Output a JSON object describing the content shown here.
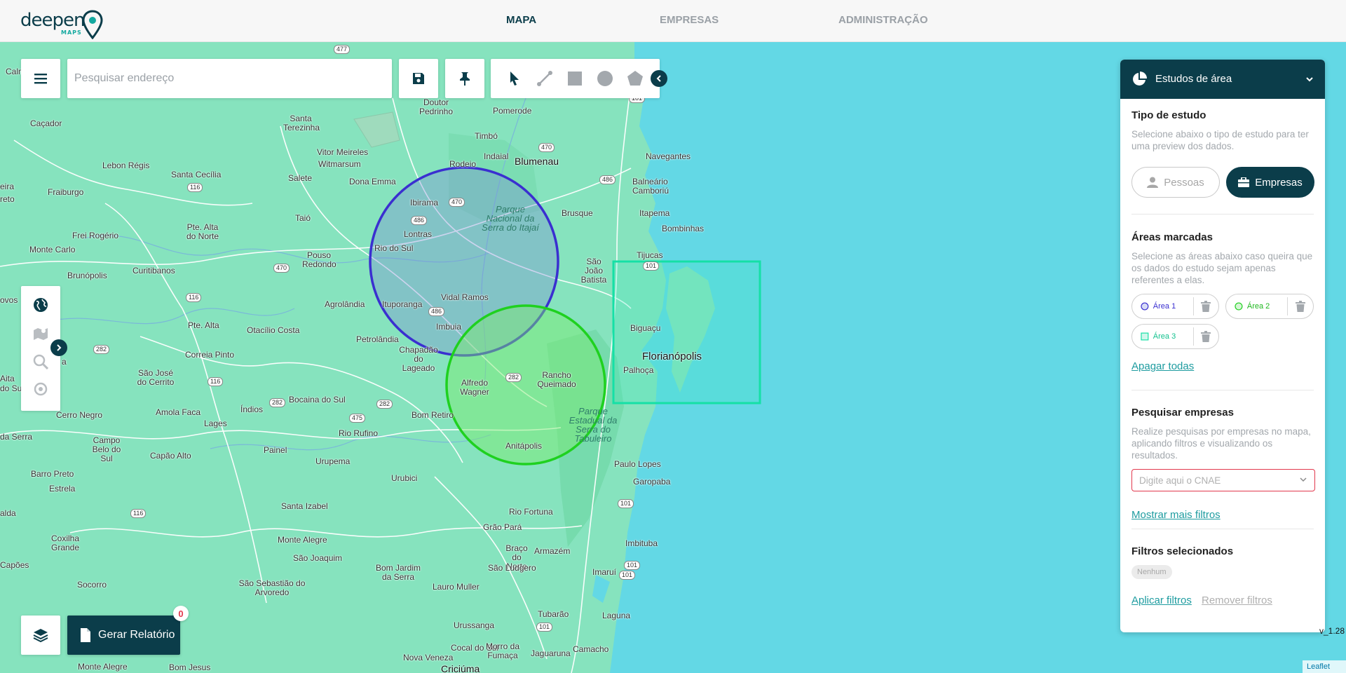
{
  "header": {
    "logo_text": "deepen",
    "logo_sub": "MAPS",
    "nav": [
      {
        "label": "MAPA",
        "active": true
      },
      {
        "label": "EMPRESAS",
        "active": false
      },
      {
        "label": "ADMINISTRAÇÃO",
        "active": false
      }
    ]
  },
  "toolbar": {
    "search_placeholder": "Pesquisar endereço",
    "icons": [
      "menu-icon",
      "save-icon",
      "pin-icon",
      "pointer-icon",
      "line-icon",
      "square-icon",
      "circle-icon",
      "polygon-icon",
      "chevron-left-icon"
    ]
  },
  "left_tools": {
    "icons": [
      "globe-icon",
      "map-icon",
      "zoom-search-icon",
      "location-icon",
      "chevron-right-icon"
    ]
  },
  "report": {
    "label": "Gerar Relatório",
    "count": "0"
  },
  "map": {
    "places": [
      {
        "name": "Blumenau",
        "size": "big"
      },
      {
        "name": "Florianópolis",
        "size": "bigger"
      },
      {
        "name": "Rio do Sul"
      },
      {
        "name": "Ibirama"
      },
      {
        "name": "Lontras"
      },
      {
        "name": "Ituporanga"
      },
      {
        "name": "Vidal Ramos"
      },
      {
        "name": "Imbuia"
      },
      {
        "name": "Chapadão do Lageado"
      },
      {
        "name": "Alfredo Wagner"
      },
      {
        "name": "Rancho Queimado"
      },
      {
        "name": "Anitápolis"
      },
      {
        "name": "Biguaçu"
      },
      {
        "name": "Palhoça"
      },
      {
        "name": "Tijucas"
      },
      {
        "name": "São João Batista"
      },
      {
        "name": "Brusque"
      },
      {
        "name": "Itapema"
      },
      {
        "name": "Bombinhas"
      },
      {
        "name": "Balneário Camboriú"
      },
      {
        "name": "Navegantes"
      },
      {
        "name": "Pomerode"
      },
      {
        "name": "Timbó"
      },
      {
        "name": "Indaial"
      },
      {
        "name": "Rodeio"
      },
      {
        "name": "Doutor Pedrinho"
      },
      {
        "name": "Santa Terezinha"
      },
      {
        "name": "Vitor Meireles"
      },
      {
        "name": "Witmarsum"
      },
      {
        "name": "Dona Emma"
      },
      {
        "name": "Salete"
      },
      {
        "name": "Taió"
      },
      {
        "name": "Pouso Redondo"
      },
      {
        "name": "Agrolândia"
      },
      {
        "name": "Petrolândia"
      },
      {
        "name": "Otacílio Costa"
      },
      {
        "name": "Pte. Alta"
      },
      {
        "name": "Pte. Alta do Norte"
      },
      {
        "name": "Santa Cecília"
      },
      {
        "name": "Lebon Régis"
      },
      {
        "name": "Caçador"
      },
      {
        "name": "Fraiburgo"
      },
      {
        "name": "Frei Rogério"
      },
      {
        "name": "Monte Carlo"
      },
      {
        "name": "Brunópolis"
      },
      {
        "name": "Curitibanos"
      },
      {
        "name": "São José do Cerrito"
      },
      {
        "name": "Correia Pinto"
      },
      {
        "name": "Bocaina do Sul"
      },
      {
        "name": "Índios"
      },
      {
        "name": "Amola Faca"
      },
      {
        "name": "Lages"
      },
      {
        "name": "Cerro Negro"
      },
      {
        "name": "Campo Belo do Sul"
      },
      {
        "name": "Capão Alto"
      },
      {
        "name": "Painel"
      },
      {
        "name": "Urupema"
      },
      {
        "name": "Rio Rufino"
      },
      {
        "name": "Bom Retiro"
      },
      {
        "name": "Urubici"
      },
      {
        "name": "Santa Izabel"
      },
      {
        "name": "Monte Alegre"
      },
      {
        "name": "São Joaquim"
      },
      {
        "name": "Bom Jardim da Serra"
      },
      {
        "name": "Lauro Muller"
      },
      {
        "name": "São Sebastião do Arvoredo"
      },
      {
        "name": "Socorro"
      },
      {
        "name": "Coxilha Grande"
      },
      {
        "name": "Capões"
      },
      {
        "name": "Barro Preto"
      },
      {
        "name": "Estrela"
      },
      {
        "name": "Paulo Lopes"
      },
      {
        "name": "Garopaba"
      },
      {
        "name": "Rio Fortuna"
      },
      {
        "name": "Grão Pará"
      },
      {
        "name": "Braço do Norte"
      },
      {
        "name": "Armazém"
      },
      {
        "name": "São Ludgero"
      },
      {
        "name": "Imbituba"
      },
      {
        "name": "Imaruí"
      },
      {
        "name": "Tubarão"
      },
      {
        "name": "Laguna"
      },
      {
        "name": "Urussanga"
      },
      {
        "name": "Cocal do Sul"
      },
      {
        "name": "Morro da Fumaça"
      },
      {
        "name": "Jaguaruna"
      },
      {
        "name": "Camacho"
      },
      {
        "name": "Nova Veneza"
      },
      {
        "name": "Criciúma"
      },
      {
        "name": "Bom Jesus"
      },
      {
        "name": "Monte Alegre"
      },
      {
        "name": "Calm"
      },
      {
        "name": "eira"
      },
      {
        "name": "reto"
      },
      {
        "name": "ovos"
      },
      {
        "name": "Aita"
      },
      {
        "name": "a"
      },
      {
        "name": "do Sul"
      },
      {
        "name": "da Serra"
      },
      {
        "name": "alda"
      }
    ],
    "parks": [
      "Parque Nacional da Serra do Itajaí",
      "Parque Estadual da Serra do Tabuleiro"
    ],
    "roads": [
      "477",
      "470",
      "470",
      "470",
      "486",
      "486",
      "486",
      "101",
      "101",
      "101",
      "116",
      "116",
      "116",
      "116",
      "282",
      "282",
      "282",
      "282",
      "475",
      "101",
      "101",
      "101"
    ],
    "areas": [
      {
        "name": "Área 1",
        "shape": "circle",
        "color": "#3a2fd0"
      },
      {
        "name": "Área 2",
        "shape": "circle",
        "color": "#1fd11f"
      },
      {
        "name": "Área 3",
        "shape": "rectangle",
        "color": "#15e0a6"
      }
    ]
  },
  "panel": {
    "title": "Estudos de área",
    "sections": {
      "tipo_title": "Tipo de estudo",
      "tipo_desc": "Selecione abaixo o tipo de estudo para ter uma preview dos dados.",
      "btn_pessoas": "Pessoas",
      "btn_empresas": "Empresas",
      "areas_title": "Áreas marcadas",
      "areas_desc": "Selecione as áreas abaixo caso queira que os dados do estudo sejam apenas referentes a elas.",
      "area1": "Área 1",
      "area2": "Área 2",
      "area3": "Área 3",
      "apagar": "Apagar todas",
      "pesquisar_title": "Pesquisar empresas",
      "pesquisar_desc": "Realize pesquisas por empresas no mapa, aplicando filtros e visualizando os resultados.",
      "cnae_placeholder": "Digite aqui o CNAE",
      "mais_filtros": "Mostrar mais filtros",
      "filtros_title": "Filtros selecionados",
      "nenhum": "Nenhum",
      "aplicar": "Aplicar filtros",
      "remover": "Remover filtros"
    }
  },
  "footer": {
    "version": "v_1.28",
    "attribution": "Leaflet"
  },
  "colors": {
    "brand": "#0b3d4a",
    "accent": "#1e9ca0",
    "land": "#7de0b8",
    "sea": "#63d8e5",
    "error": "#e2384d"
  }
}
